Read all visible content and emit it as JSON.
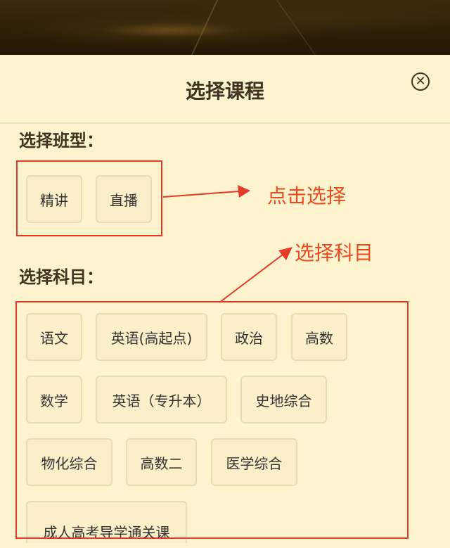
{
  "header": {
    "title": "选择课程",
    "close_icon": "close-circle-icon"
  },
  "class_type": {
    "label": "选择班型：",
    "options": [
      "精讲",
      "直播"
    ]
  },
  "subjects": {
    "label": "选择科目：",
    "options": [
      "语文",
      "英语(高起点)",
      "政治",
      "高数",
      "数学",
      "英语（专升本）",
      "史地综合",
      "物化综合",
      "高数二",
      "医学综合",
      "成人高考导学通关课"
    ]
  },
  "annotations": {
    "class_hint": "点击选择",
    "subject_hint": "选择科目",
    "color": "#ee4a1c"
  },
  "colors": {
    "background": "#fdf3cf",
    "chip_border": "#eadcae",
    "highlight_box": "#e53a2a"
  }
}
